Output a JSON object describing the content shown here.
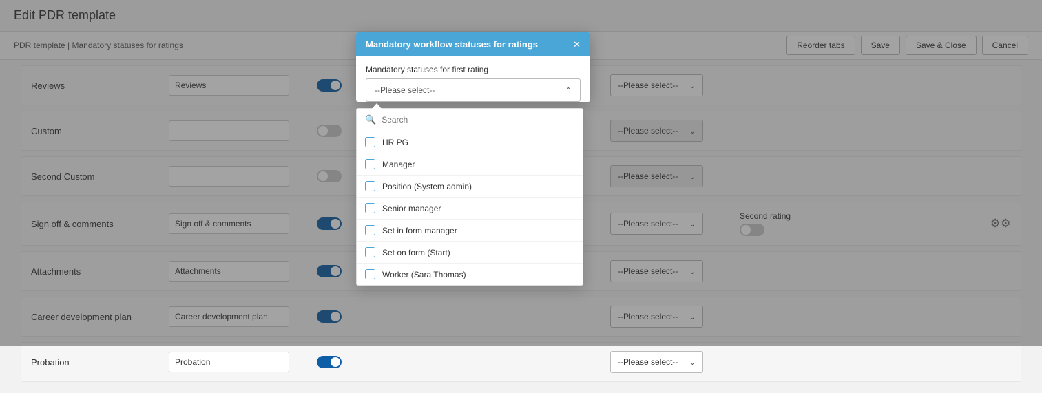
{
  "pageTitle": "Edit PDR template",
  "breadcrumb": "PDR template | Mandatory statuses for ratings",
  "topButtons": {
    "reorder": "Reorder tabs",
    "save": "Save",
    "saveClose": "Save & Close",
    "cancel": "Cancel"
  },
  "rows": [
    {
      "label": "Reviews",
      "input": "Reviews",
      "toggle": "on",
      "select": "--Please select--",
      "selectStyle": "plain"
    },
    {
      "label": "Custom",
      "input": "",
      "toggle": "off",
      "select": "--Please select--",
      "selectStyle": "filled"
    },
    {
      "label": "Second Custom",
      "input": "",
      "toggle": "off",
      "select": "--Please select--",
      "selectStyle": "filled"
    },
    {
      "label": "Sign off & comments",
      "input": "Sign off & comments",
      "toggle": "on",
      "select": "--Please select--",
      "selectStyle": "plain",
      "extraLabel": "Second rating",
      "extraToggle": "off",
      "gear": true
    },
    {
      "label": "Attachments",
      "input": "Attachments",
      "toggle": "on",
      "select": "--Please select--",
      "selectStyle": "plain"
    },
    {
      "label": "Career development plan",
      "input": "Career development plan",
      "toggle": "on",
      "select": "--Please select--",
      "selectStyle": "plain"
    },
    {
      "label": "Probation",
      "input": "Probation",
      "toggle": "on",
      "select": "--Please select--",
      "selectStyle": "plain"
    }
  ],
  "modal": {
    "title": "Mandatory workflow statuses for ratings",
    "fieldLabel": "Mandatory statuses for first rating",
    "placeholder": "--Please select--"
  },
  "dropdown": {
    "searchPlaceholder": "Search",
    "options": [
      "HR PG",
      "Manager",
      "Position (System admin)",
      "Senior manager",
      "Set in form manager",
      "Set on form (Start)",
      "Worker (Sara Thomas)"
    ]
  }
}
